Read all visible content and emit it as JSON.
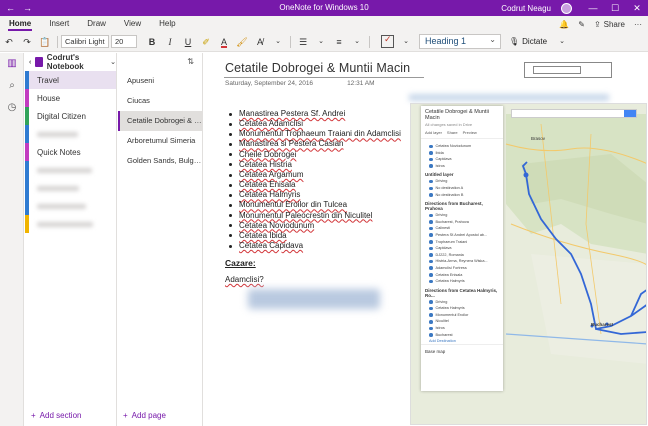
{
  "window": {
    "title": "OneNote for Windows 10",
    "user": "Codrut Neagu",
    "controls": {
      "minimize": "—",
      "maximize": "☐",
      "close": "✕"
    }
  },
  "ribbon": {
    "tabs": [
      "Home",
      "Insert",
      "Draw",
      "View",
      "Help"
    ],
    "active_tab": "Home",
    "share_label": "Share",
    "more_label": "···",
    "font_name": "Calibri Light",
    "font_size": "20",
    "style": "Heading 1",
    "dictate_label": "Dictate",
    "accent": "#7719aa"
  },
  "notebook": {
    "name": "Codrut's Notebook",
    "sections": [
      {
        "name": "Travel",
        "color": "#2f7bd1",
        "active": true
      },
      {
        "name": "House",
        "color": "#c23cc0",
        "active": false
      },
      {
        "name": "Digital Citizen",
        "color": "#31a35a",
        "active": false
      },
      {
        "name": "",
        "color": "#2f7bd1",
        "active": false
      },
      {
        "name": "Quick Notes",
        "color": "#c23cc0",
        "active": false
      },
      {
        "name": "",
        "color": "#2f7bd1",
        "active": false
      },
      {
        "name": "",
        "color": "#2f7bd1",
        "active": false
      },
      {
        "name": "",
        "color": "#2f7bd1",
        "active": false
      },
      {
        "name": "",
        "color": "#f0b400",
        "active": false
      }
    ],
    "add_section_label": "Add section"
  },
  "pages": {
    "items": [
      "Apuseni",
      "Ciucas",
      "Cetatile Dobrogei & M...",
      "Arboretumul Simeria",
      "Golden Sands, Bulgaria..."
    ],
    "active_index": 2,
    "add_page_label": "Add page"
  },
  "page": {
    "title": "Cetatile Dobrogei & Muntii Macin",
    "date": "Saturday, September 24, 2016",
    "time": "12:31 AM",
    "list": [
      "Manastirea Pestera Sf. Andrei",
      "Cetatea Adamclisi",
      "Monumentul Trophaeum Traiani din Adamclisi",
      "Manastirea si Pestera Casian",
      "Cheile Dobrogei",
      "Cetatea Histria",
      "Cetatea Argamum",
      "Cetatea Enisala",
      "Cetatea Halmyris",
      "Monumentul Eroilor din Tulcea",
      "Monumentul Paleocrestin din Niculitel",
      "Cetatea Noviodunum",
      "Cetatea Ibida",
      "Cetatea Capidava"
    ],
    "cazare_heading": "Cazare:",
    "cazare_text": "Adamclisi?"
  },
  "map": {
    "panel_title": "Cetatile Dobrogei & Muntii Macin",
    "panel_sub": "All changes saved in Drive",
    "actions": [
      "Add layer",
      "Share",
      "Preview"
    ],
    "layers": [
      {
        "name": "",
        "rows": [
          "Cetatea Noviodunum",
          "Ibida",
          "Capidava",
          "Istros"
        ]
      },
      {
        "name": "Untitled layer",
        "rows": [
          "Driving",
          "No destination A",
          "No destination B"
        ]
      },
      {
        "name": "Directions from Bucharest, Prahova",
        "rows": [
          "Driving",
          "Bucharest, Prahova",
          "Calinesti",
          "Pestera Sf.Andrei Apostol ab...",
          "Trophaeum Traiani",
          "Capidava",
          "DJ222, Romania",
          "Histria-Arma, Reynera Wiska...",
          "Adamclisi Fortress",
          "Cetatea Enisala",
          "Cetatea Halmyris"
        ]
      },
      {
        "name": "Directions from Cetatea Halmyris, Ro...",
        "rows": [
          "Driving",
          "Cetatea Halmyris",
          "Monumentul Eroilor",
          "Niculitel",
          "Istros",
          "Bucharest"
        ]
      }
    ],
    "add_destination": "Add Destination",
    "base_map": "Base map",
    "labels": {
      "brasov": "Brasov",
      "bucharest": "Bucharest"
    },
    "route_color": "#3367d6"
  }
}
